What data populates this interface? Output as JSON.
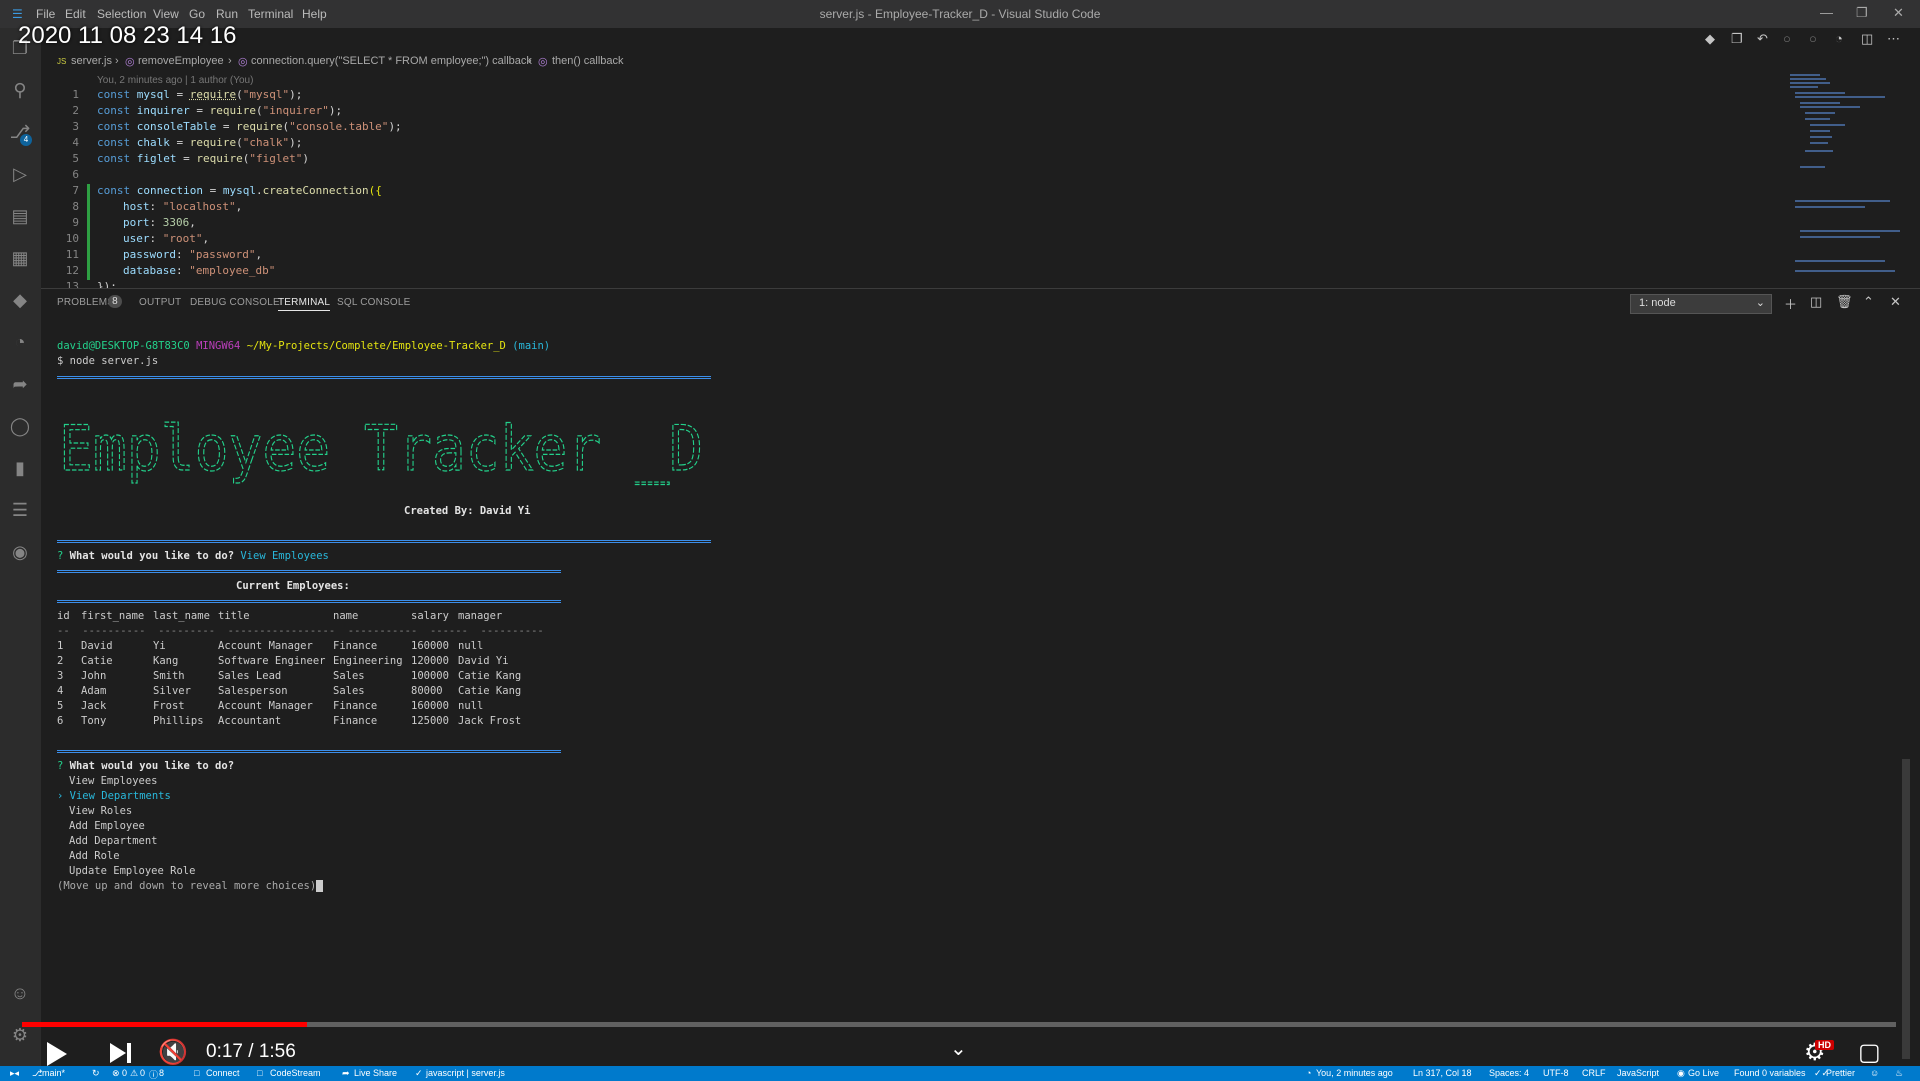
{
  "overlay": {
    "timestamp": "2020 11 08 23 14 16",
    "timecode": "0:17 / 1:56",
    "progress": 0.152,
    "hd_badge": "HD"
  },
  "titlebar": {
    "menu": [
      "File",
      "Edit",
      "Selection",
      "View",
      "Go",
      "Run",
      "Terminal",
      "Help"
    ],
    "window_title": "server.js - Employee-Tracker_D - Visual Studio Code"
  },
  "breadcrumb": {
    "file": "server.js",
    "items": [
      "removeEmployee",
      "connection.query(\"SELECT * FROM employee;\") callback",
      "then() callback"
    ]
  },
  "codelens": "You, 2 minutes ago | 1 author (You)",
  "code": {
    "line_numbers": [
      "1",
      "2",
      "3",
      "4",
      "5",
      "6",
      "7",
      "8",
      "9",
      "10",
      "11",
      "12",
      "13"
    ],
    "l1": [
      "const ",
      "mysql",
      " = ",
      "require",
      "(",
      "\"mysql\"",
      ");"
    ],
    "l2": [
      "const ",
      "inquirer",
      " = ",
      "require",
      "(",
      "\"inquirer\"",
      ");"
    ],
    "l3": [
      "const ",
      "consoleTable",
      " = ",
      "require",
      "(",
      "\"console.table\"",
      ");"
    ],
    "l4": [
      "const ",
      "chalk",
      " = ",
      "require",
      "(",
      "\"chalk\"",
      ");"
    ],
    "l5": [
      "const ",
      "figlet",
      " = ",
      "require",
      "(",
      "\"figlet\"",
      ")"
    ],
    "l7": [
      "const ",
      "connection",
      " = ",
      "mysql",
      ".",
      "createConnection",
      "({"
    ],
    "l8": [
      "host",
      ": ",
      "\"localhost\"",
      ","
    ],
    "l9": [
      "port",
      ": ",
      "3306",
      ","
    ],
    "l10": [
      "user",
      ": ",
      "\"root\"",
      ","
    ],
    "l11": [
      "password",
      ": ",
      "\"password\"",
      ","
    ],
    "l12": [
      "database",
      ": ",
      "\"employee_db\""
    ],
    "l13": "});"
  },
  "panel": {
    "tabs": [
      "PROBLEMS",
      "OUTPUT",
      "DEBUG CONSOLE",
      "TERMINAL",
      "SQL CONSOLE"
    ],
    "problems_count": "8",
    "terminal_select": "1: node"
  },
  "terminal": {
    "prompt_user": "david@DESKTOP-G8T83C0",
    "prompt_env": "MINGW64",
    "prompt_path": "~/My-Projects/Complete/Employee-Tracker_D",
    "prompt_branch": "(main)",
    "command": "$ node server.js",
    "banner_text": "Employee Tracker _D",
    "created_by": "Created By: David Yi",
    "question1": "What would you like to do?",
    "answer1": "View Employees",
    "table_title": "Current Employees:",
    "table_headers": [
      "id",
      "first_name",
      "last_name",
      "title",
      "name",
      "salary",
      "manager"
    ],
    "table_rows": [
      [
        "1",
        "David",
        "Yi",
        "Account Manager",
        "Finance",
        "160000",
        "null"
      ],
      [
        "2",
        "Catie",
        "Kang",
        "Software Engineer",
        "Engineering",
        "120000",
        "David Yi"
      ],
      [
        "3",
        "John",
        "Smith",
        "Sales Lead",
        "Sales",
        "100000",
        "Catie Kang"
      ],
      [
        "4",
        "Adam",
        "Silver",
        "Salesperson",
        "Sales",
        "80000",
        "Catie Kang"
      ],
      [
        "5",
        "Jack",
        "Frost",
        "Account Manager",
        "Finance",
        "160000",
        "null"
      ],
      [
        "6",
        "Tony",
        "Phillips",
        "Accountant",
        "Finance",
        "125000",
        "Jack Frost"
      ]
    ],
    "question2": "What would you like to do?",
    "choices": [
      "View Employees",
      "View Departments",
      "View Roles",
      "Add Employee",
      "Add Department",
      "Add Role",
      "Update Employee Role"
    ],
    "selected_choice_index": 1,
    "hint": "(Move up and down to reveal more choices)"
  },
  "statusbar": {
    "branch": "main*",
    "errors": "0",
    "warnings": "0",
    "info": "8",
    "connect": "Connect",
    "codestream": "CodeStream",
    "liveshare": "Live Share",
    "context": "javascript | server.js",
    "blame": "You, 2 minutes ago",
    "position": "Ln 317, Col 18",
    "spaces": "Spaces: 4",
    "encoding": "UTF-8",
    "eol": "CRLF",
    "language": "JavaScript",
    "golive": "Go Live",
    "vars": "Found 0 variables",
    "prettier": "Prettier"
  },
  "colors": {
    "statusbar": "#007acc",
    "progress": "#ff0000",
    "banner": "#23d18b",
    "accent": "#3b8eea"
  }
}
